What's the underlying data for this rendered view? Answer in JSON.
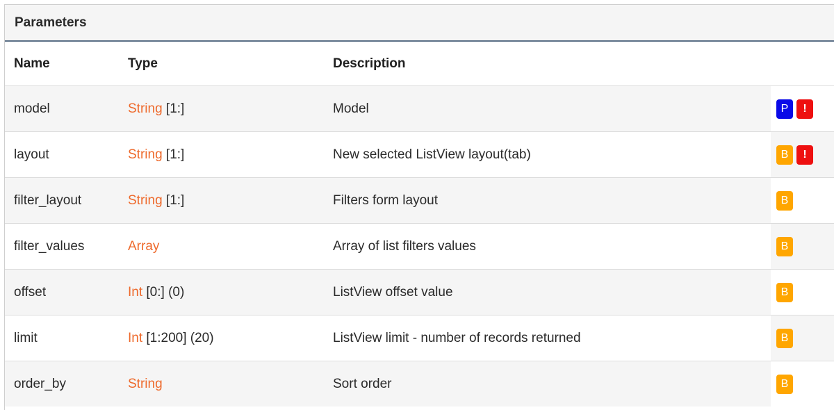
{
  "panel": {
    "title": "Parameters"
  },
  "headers": {
    "name": "Name",
    "type": "Type",
    "description": "Description"
  },
  "colors": {
    "type_accent": "#ee6a2c",
    "badge_P": "#0a0ae8",
    "badge_B": "#ffa600",
    "badge_required": "#ee1010"
  },
  "rows": [
    {
      "name": "model",
      "type": "String",
      "type_extra": "[1:]",
      "description": "Model",
      "badges": [
        "P",
        "!"
      ]
    },
    {
      "name": "layout",
      "type": "String",
      "type_extra": "[1:]",
      "description": "New selected ListView layout(tab)",
      "badges": [
        "B",
        "!"
      ]
    },
    {
      "name": "filter_layout",
      "type": "String",
      "type_extra": "[1:]",
      "description": "Filters form layout",
      "badges": [
        "B"
      ]
    },
    {
      "name": "filter_values",
      "type": "Array",
      "type_extra": "",
      "description": "Array of list filters values",
      "badges": [
        "B"
      ]
    },
    {
      "name": "offset",
      "type": "Int",
      "type_extra": "[0:] (0)",
      "description": "ListView offset value",
      "badges": [
        "B"
      ]
    },
    {
      "name": "limit",
      "type": "Int",
      "type_extra": "[1:200] (20)",
      "description": "ListView limit - number of records returned",
      "badges": [
        "B"
      ]
    },
    {
      "name": "order_by",
      "type": "String",
      "type_extra": "",
      "description": "Sort order",
      "badges": [
        "B"
      ]
    }
  ]
}
